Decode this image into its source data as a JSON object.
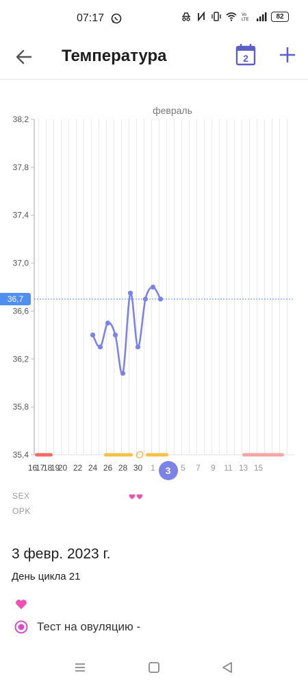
{
  "status": {
    "time": "07:17",
    "battery": "82"
  },
  "header": {
    "title": "Температура",
    "calendar_day": "2"
  },
  "chart_data": {
    "type": "line",
    "title": "февраль",
    "ylim": [
      35.4,
      38.2
    ],
    "y_ticks": [
      "38,2",
      "37,8",
      "37,4",
      "37,0",
      "36,6",
      "36,2",
      "35,8",
      "35,4"
    ],
    "x_ticks": [
      "16",
      "18",
      "20",
      "22",
      "24",
      "26",
      "28",
      "30",
      "1",
      "3",
      "5",
      "7",
      "9",
      "11",
      "13",
      "15",
      "17",
      "19"
    ],
    "cover_line": {
      "value": 36.7,
      "label": "36,7"
    },
    "selected_day": "3",
    "series": [
      {
        "x": [
          24,
          25,
          26,
          27,
          28,
          29,
          30,
          31,
          1,
          2
        ],
        "values": [
          36.4,
          36.3,
          36.5,
          36.4,
          36.08,
          36.75,
          36.3,
          36.7,
          36.8,
          36.7
        ]
      }
    ],
    "ovulation_marker": "O",
    "grid": true
  },
  "rows": {
    "sex_label": "SEX",
    "opk_label": "OPK"
  },
  "details": {
    "date": "3 февр. 2023 г.",
    "cycle_day": "День цикла 21",
    "ovulation_test": "Тест на овуляцию -"
  },
  "colors": {
    "accent": "#5b5fc7",
    "line": "#7b83e8",
    "cover_line": "#4f8ff2",
    "period": "#f06a6a",
    "fertile": "#f7c04a",
    "heart": "#ef4fb0"
  }
}
